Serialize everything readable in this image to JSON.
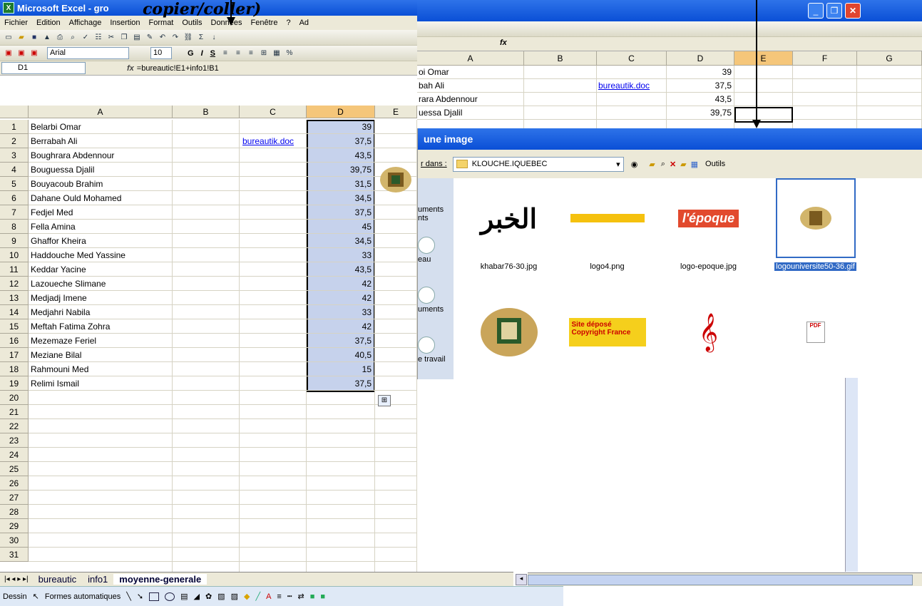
{
  "main": {
    "title": "Microsoft Excel - gro",
    "menu": [
      "Fichier",
      "Edition",
      "Affichage",
      "Insertion",
      "Format",
      "Outils",
      "Données",
      "Fenêtre",
      "?",
      "Ad"
    ],
    "font_name": "Arial",
    "font_size": "10",
    "format_buttons": [
      "G",
      "I",
      "S"
    ],
    "namebox": "D1",
    "formula": "=bureautic!E1+info1!B1",
    "columns": [
      "A",
      "B",
      "C",
      "D",
      "E"
    ],
    "row_numbers": [
      "1",
      "2",
      "3",
      "4",
      "5",
      "6",
      "7",
      "8",
      "9",
      "10",
      "11",
      "12",
      "13",
      "14",
      "15",
      "16",
      "17",
      "18",
      "19",
      "20",
      "21",
      "22",
      "23",
      "24",
      "25",
      "26",
      "27",
      "28",
      "29",
      "30",
      "31",
      "32"
    ],
    "names": [
      "Belarbi Omar",
      "Berrabah Ali",
      "Boughrara Abdennour",
      "Bouguessa Djalil",
      "Bouyacoub Brahim",
      "Dahane Ould Mohamed",
      "Fedjel Med",
      "Fella Amina",
      "Ghaffor Kheira",
      "Haddouche Med Yassine",
      "Keddar Yacine",
      "Lazoueche Slimane",
      "Medjadj Imene",
      "Medjahri Nabila",
      "Meftah Fatima Zohra",
      "Mezemaze Feriel",
      "Meziane Bilal",
      "Rahmouni Med",
      "Relimi Ismail"
    ],
    "values": [
      "39",
      "37,5",
      "43,5",
      "39,75",
      "31,5",
      "34,5",
      "37,5",
      "45",
      "34,5",
      "33",
      "43,5",
      "42",
      "42",
      "33",
      "42",
      "37,5",
      "40,5",
      "15",
      "37,5"
    ],
    "link_text": "bureautik.doc",
    "sheet_tabs": [
      "bureautic",
      "info1",
      "moyenne-generale"
    ],
    "draw_menu": "Dessin",
    "autoshapes_menu": "Formes automatiques"
  },
  "second": {
    "columns": [
      "A",
      "B",
      "C",
      "D",
      "E",
      "F",
      "G"
    ],
    "names": [
      "oi Omar",
      "bah Ali",
      "rara Abdennour",
      "uessa Djalil"
    ],
    "values": [
      "39",
      "37,5",
      "43,5",
      "39,75"
    ],
    "link_text": "bureautik.doc"
  },
  "annotation": "copier/coller)",
  "dialog": {
    "title": "une image",
    "look_in_label": "r dans :",
    "folder": "KLOUCHE.IQUEBEC",
    "tools_label": "Outils",
    "places": [
      "uments\nnts",
      "eau",
      "uments",
      "e travail"
    ],
    "files": [
      {
        "name": "khabar76-30.jpg",
        "label": "الخبر"
      },
      {
        "name": "logo4.png",
        "label": ""
      },
      {
        "name": "logo-epoque.jpg",
        "label": "l'époque"
      },
      {
        "name": "logouniversite50-36.gif",
        "label": ""
      },
      {
        "name": "",
        "label": ""
      },
      {
        "name": "",
        "label": "Site déposé\nCopyright France"
      },
      {
        "name": "",
        "label": "𝄞"
      },
      {
        "name": "",
        "label": "PDF"
      }
    ]
  }
}
